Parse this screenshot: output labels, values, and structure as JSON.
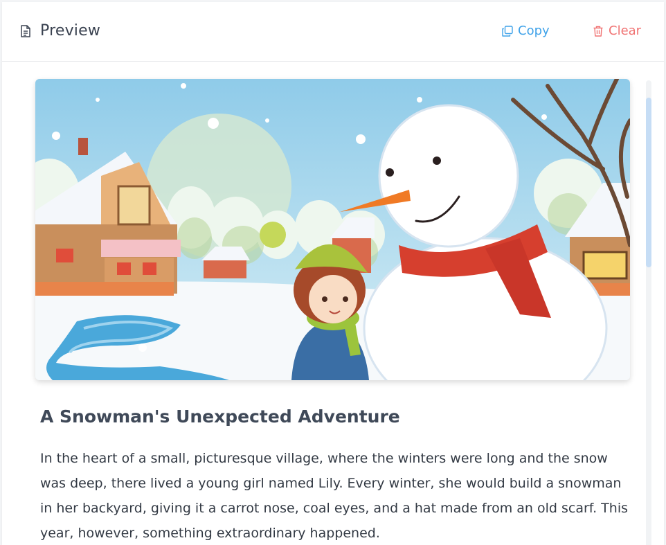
{
  "header": {
    "title": "Preview",
    "copy_label": "Copy",
    "clear_label": "Clear"
  },
  "icons": {
    "title": "document-icon",
    "copy": "copy-icon",
    "clear": "trash-icon"
  },
  "colors": {
    "accent": "#3fa2e9",
    "danger": "#f07272",
    "title_text": "#3a4250",
    "body_text": "#333a44"
  },
  "story": {
    "title": "A Snowman's Unexpected Adventure",
    "body": "In the heart of a small, picturesque village, where the winters were long and the snow was deep, there lived a young girl named Lily. Every winter, she would build a snowman in her backyard, giving it a carrot nose, coal eyes, and a hat made from an old scarf. This year, however, something extraordinary happened."
  }
}
